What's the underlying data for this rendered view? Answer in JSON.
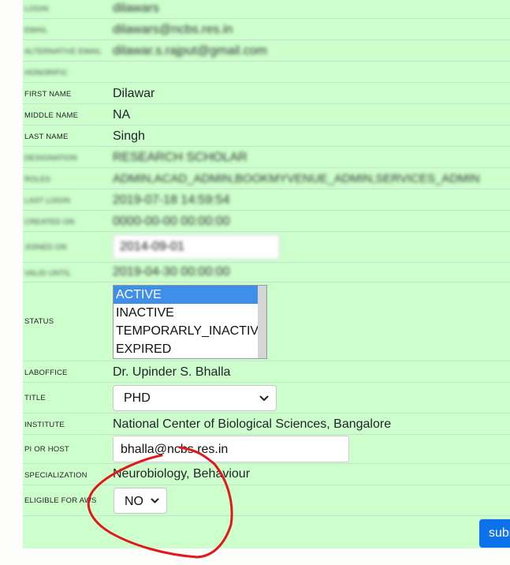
{
  "fields": {
    "login": {
      "label": "LOGIN",
      "value": "dilawars"
    },
    "email": {
      "label": "EMAIL",
      "value": "dilawars@ncbs.res.in"
    },
    "alt_email": {
      "label": "ALTERNATIVE EMAIL",
      "value": "dilawar.s.rajput@gmail.com"
    },
    "honorific": {
      "label": "HONORIFIC",
      "value": ""
    },
    "first_name": {
      "label": "FIRST NAME",
      "value": "Dilawar"
    },
    "middle_name": {
      "label": "MIDDLE NAME",
      "value": "NA"
    },
    "last_name": {
      "label": "LAST NAME",
      "value": "Singh"
    },
    "designation": {
      "label": "DESIGNATION",
      "value": "RESEARCH SCHOLAR"
    },
    "roles": {
      "label": "ROLES",
      "value": "ADMIN,ACAD_ADMIN,BOOKMYVENUE_ADMIN,SERVICES_ADMIN"
    },
    "last_login": {
      "label": "LAST LOGIN",
      "value": "2019-07-18 14:59:54"
    },
    "created_on": {
      "label": "CREATED ON",
      "value": "0000-00-00 00:00:00"
    },
    "joined_on": {
      "label": "JOINED ON",
      "value": "2014-09-01"
    },
    "valid_until": {
      "label": "VALID UNTIL",
      "value": "2019-04-30 00:00:00"
    },
    "status": {
      "label": "STATUS",
      "options": [
        "ACTIVE",
        "INACTIVE",
        "TEMPORARLY_INACTIVE",
        "EXPIRED"
      ],
      "selected": "ACTIVE"
    },
    "laboffice": {
      "label": "LABOFFICE",
      "value": "Dr. Upinder S. Bhalla"
    },
    "title": {
      "label": "TITLE",
      "value": "PHD"
    },
    "institute": {
      "label": "INSTITUTE",
      "value": "National Center of Biological Sciences, Bangalore"
    },
    "pi_or_host": {
      "label": "PI OR HOST",
      "value": "bhalla@ncbs.res.in"
    },
    "specialization": {
      "label": "SPECIALIZATION",
      "value": "Neurobiology, Behaviour"
    },
    "eligible_aws": {
      "label": "ELIGIBLE FOR AWS",
      "value": "NO"
    }
  },
  "submit_label": "submit",
  "icons": {
    "select_chevron": "chevron-down-icon"
  },
  "colors": {
    "panel_bg": "#ccffcc",
    "selected_option": "#3f8ee8",
    "submit_bg": "#0d72e9",
    "annotation": "#e0191c"
  }
}
